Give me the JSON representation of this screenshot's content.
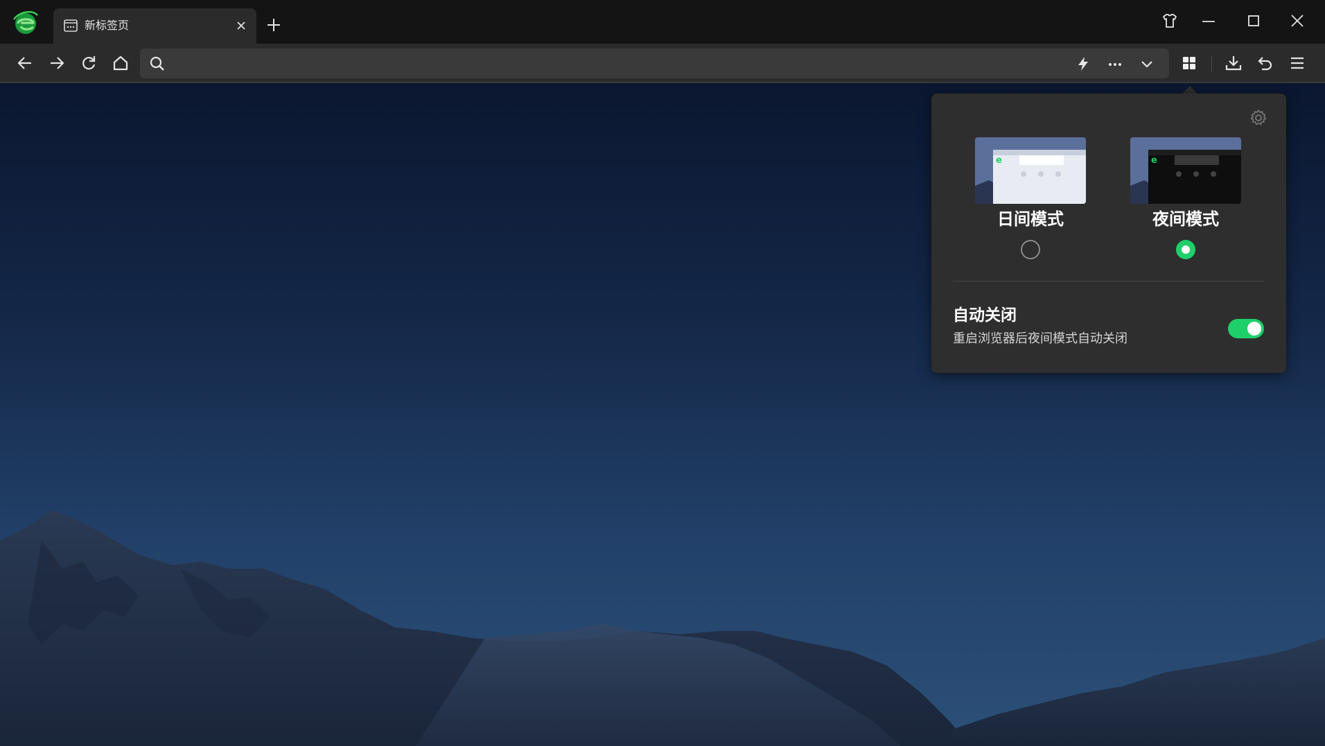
{
  "tab": {
    "title": "新标签页",
    "favicon": "new-tab-page-icon"
  },
  "address_bar": {
    "value": "",
    "placeholder": ""
  },
  "toolbar": {
    "icons": [
      "back-icon",
      "forward-icon",
      "refresh-icon",
      "home-icon",
      "search-icon",
      "lightning-icon",
      "more-icon",
      "chevron-down-icon",
      "apps-grid-icon",
      "download-icon",
      "undo-icon",
      "menu-icon"
    ]
  },
  "window_controls": [
    "skin-icon",
    "minimize-icon",
    "maximize-icon",
    "close-icon"
  ],
  "night_mode_popup": {
    "day_mode_label": "日间模式",
    "night_mode_label": "夜间模式",
    "selected_mode": "夜间模式",
    "auto_close_title": "自动关闭",
    "auto_close_desc": "重启浏览器后夜间模式自动关闭",
    "auto_close_enabled": true
  },
  "colors": {
    "accent": "#1fcf6a",
    "titlebar": "#141414",
    "toolbar": "#2b2b2b",
    "popup": "#2e2e2e"
  }
}
